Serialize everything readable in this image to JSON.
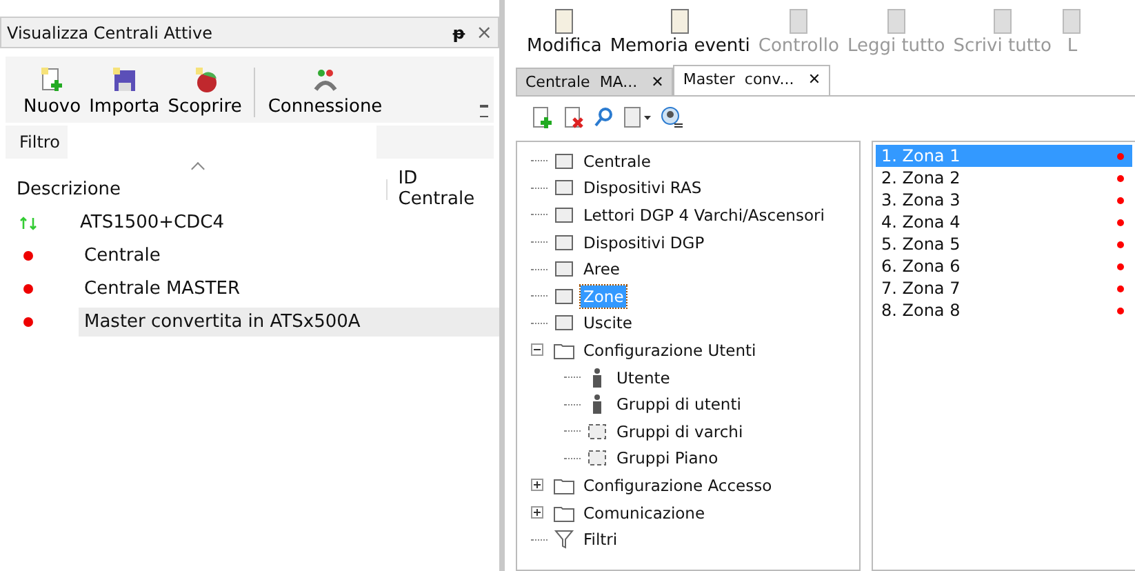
{
  "left_panel": {
    "title": "Visualizza Centrali Attive",
    "pin": "ᵽ",
    "close": "×",
    "toolbar": [
      {
        "label": "Nuovo",
        "kind": "new"
      },
      {
        "label": "Importa",
        "kind": "save"
      },
      {
        "label": "Scoprire",
        "kind": "discover"
      },
      {
        "label": "Connessione",
        "kind": "connect"
      }
    ],
    "filter": {
      "label": "Filtro"
    },
    "table": {
      "columns": [
        "Descrizione",
        "ID Centrale"
      ],
      "rows": [
        {
          "name": "ATS1500+CDC4",
          "kind": "connected",
          "selected": false
        },
        {
          "name": "Centrale",
          "kind": "disconnected",
          "selected": false
        },
        {
          "name": "Centrale MASTER",
          "kind": "disconnected",
          "selected": false
        },
        {
          "name": "Master convertita in ATSx500A",
          "kind": "disconnected",
          "selected": true
        }
      ]
    }
  },
  "main_toolbar": [
    {
      "label": "Modifica",
      "disabled": false
    },
    {
      "label": "Memoria eventi",
      "disabled": false
    },
    {
      "label": "Controllo",
      "disabled": true
    },
    {
      "label": "Leggi tutto",
      "disabled": true
    },
    {
      "label": "Scrivi tutto",
      "disabled": true
    },
    {
      "label": "L",
      "disabled": true
    }
  ],
  "tabs": [
    {
      "label": "Centrale  MA...",
      "close": "✕",
      "selected": false
    },
    {
      "label": "Master  conv...",
      "close": "✕",
      "selected": true
    }
  ],
  "tree": [
    {
      "label": "Centrale",
      "kind": "device",
      "selected": false
    },
    {
      "label": "Dispositivi RAS",
      "kind": "device",
      "selected": false
    },
    {
      "label": "Lettori DGP 4 Varchi/Ascensori",
      "kind": "device",
      "selected": false
    },
    {
      "label": "Dispositivi DGP",
      "kind": "device",
      "selected": false
    },
    {
      "label": "Aree",
      "kind": "device",
      "selected": false
    },
    {
      "label": "Zone",
      "kind": "device",
      "selected": true
    },
    {
      "label": "Uscite",
      "kind": "device",
      "selected": false
    },
    {
      "label": "Configurazione Utenti",
      "kind": "folder",
      "expanded": true,
      "selected": false,
      "children": [
        {
          "label": "Utente",
          "kind": "user",
          "selected": false
        },
        {
          "label": "Gruppi di utenti",
          "kind": "user",
          "selected": false
        },
        {
          "label": "Gruppi di varchi",
          "kind": "device",
          "selected": false
        },
        {
          "label": "Gruppi Piano",
          "kind": "device",
          "selected": false
        }
      ]
    },
    {
      "label": "Configurazione Accesso",
      "kind": "folder",
      "expanded": false,
      "selected": false
    },
    {
      "label": "Comunicazione",
      "kind": "folder",
      "expanded": false,
      "selected": false
    },
    {
      "label": "Filtri",
      "kind": "filter",
      "selected": false
    }
  ],
  "zones": [
    {
      "label": "1. Zona 1",
      "selected": true,
      "color": "#ff0000"
    },
    {
      "label": "2. Zona 2",
      "selected": false,
      "color": "#ff0000"
    },
    {
      "label": "3. Zona 3",
      "selected": false,
      "color": "#ff0000"
    },
    {
      "label": "4. Zona 4",
      "selected": false,
      "color": "#ff0000"
    },
    {
      "label": "5. Zona 5",
      "selected": false,
      "color": "#ff0000"
    },
    {
      "label": "6. Zona 6",
      "selected": false,
      "color": "#ff0000"
    },
    {
      "label": "7. Zona 7",
      "selected": false,
      "color": "#ff0000"
    },
    {
      "label": "8. Zona 8",
      "selected": false,
      "color": "#ff0000"
    }
  ]
}
